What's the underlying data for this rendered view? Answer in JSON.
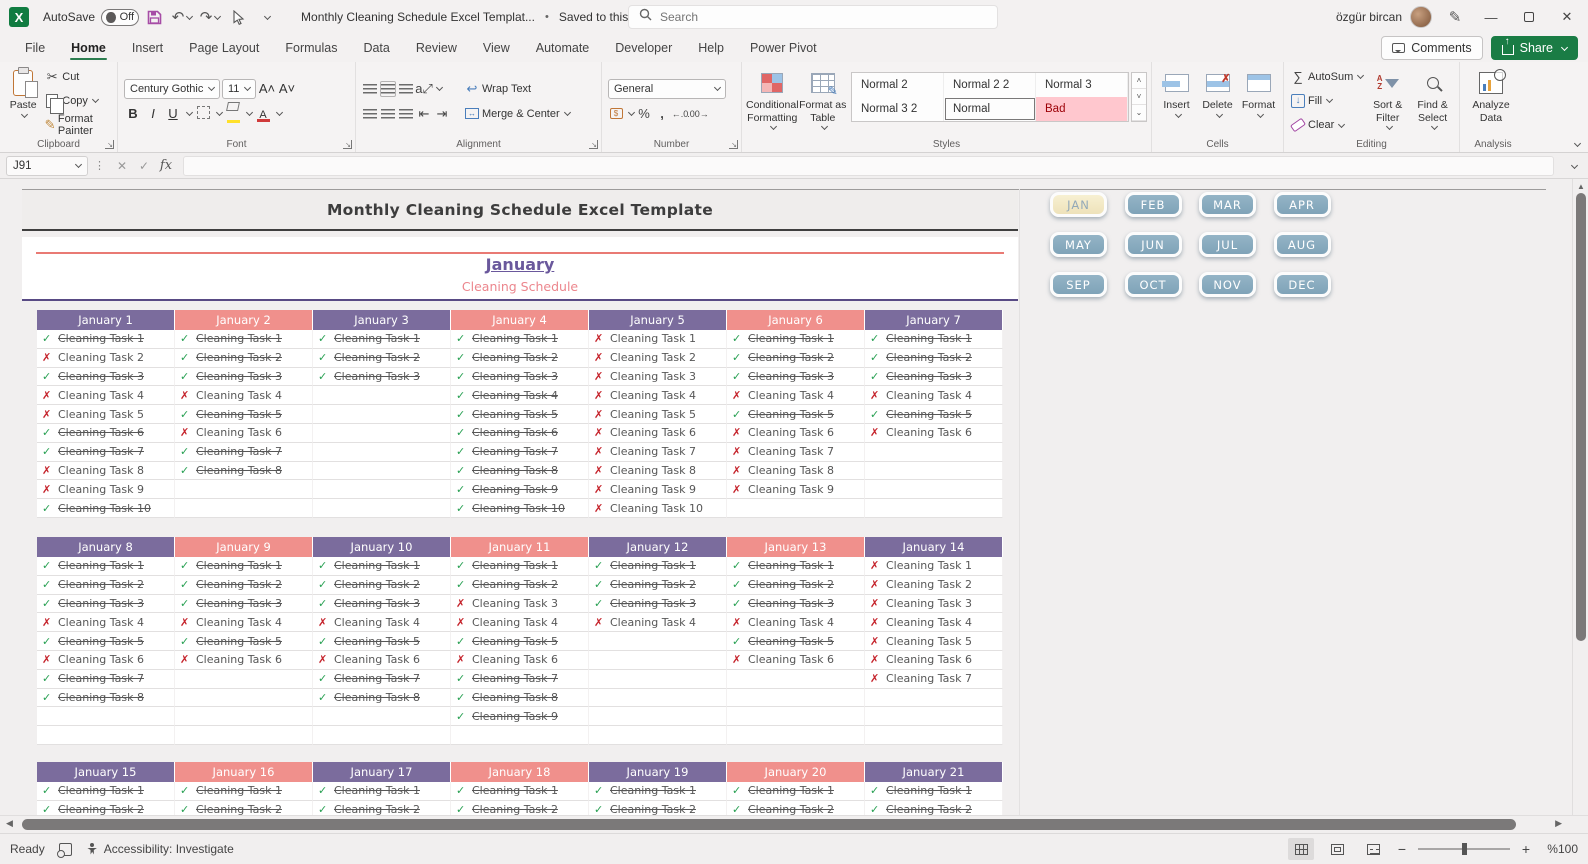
{
  "titlebar": {
    "app": "Excel",
    "autosave_label": "AutoSave",
    "autosave_state": "Off",
    "doc_title": "Monthly Cleaning Schedule Excel Templat...",
    "saved_status": "Saved to this PC",
    "search_placeholder": "Search",
    "user_name": "özgür bircan"
  },
  "ribbon_tabs": [
    {
      "label": "File",
      "active": false
    },
    {
      "label": "Home",
      "active": true
    },
    {
      "label": "Insert",
      "active": false
    },
    {
      "label": "Page Layout",
      "active": false
    },
    {
      "label": "Formulas",
      "active": false
    },
    {
      "label": "Data",
      "active": false
    },
    {
      "label": "Review",
      "active": false
    },
    {
      "label": "View",
      "active": false
    },
    {
      "label": "Automate",
      "active": false
    },
    {
      "label": "Developer",
      "active": false
    },
    {
      "label": "Help",
      "active": false
    },
    {
      "label": "Power Pivot",
      "active": false
    }
  ],
  "actions": {
    "comments": "Comments",
    "share": "Share"
  },
  "ribbon": {
    "clipboard": {
      "group": "Clipboard",
      "paste": "Paste",
      "cut": "Cut",
      "copy": "Copy",
      "format_painter": "Format Painter"
    },
    "font": {
      "group": "Font",
      "family": "Century Gothic",
      "size": "11"
    },
    "alignment": {
      "group": "Alignment",
      "wrap": "Wrap Text",
      "merge": "Merge & Center"
    },
    "number": {
      "group": "Number",
      "format": "General"
    },
    "styles": {
      "group": "Styles",
      "conditional": "Conditional\nFormatting",
      "format_table": "Format as\nTable",
      "gallery": [
        {
          "label": "Normal 2",
          "state": "normal"
        },
        {
          "label": "Normal 2 2",
          "state": "normal"
        },
        {
          "label": "Normal 3",
          "state": "normal"
        },
        {
          "label": "Normal 3 2",
          "state": "normal"
        },
        {
          "label": "Normal",
          "state": "selected"
        },
        {
          "label": "Bad",
          "state": "bad"
        }
      ]
    },
    "cells": {
      "group": "Cells",
      "insert": "Insert",
      "delete": "Delete",
      "format": "Format"
    },
    "editing": {
      "group": "Editing",
      "autosum": "AutoSum",
      "fill": "Fill",
      "clear": "Clear",
      "sort": "Sort &\nFilter",
      "find": "Find &\nSelect"
    },
    "analysis": {
      "group": "Analysis",
      "analyze": "Analyze\nData"
    }
  },
  "formula_bar": {
    "name_box": "J91"
  },
  "sheet": {
    "title": "Monthly Cleaning Schedule Excel Template",
    "month_title": "January",
    "subtitle": "Cleaning Schedule",
    "task_label_prefix": "Cleaning Task",
    "colors": {
      "header_purple": "#7b6c9d",
      "header_salmon": "#f0908c",
      "done_green": "#27a052",
      "missed_red": "#c5232b",
      "month_btn_blue": "#86a9bd",
      "month_btn_active": "#f3ecca"
    },
    "months": [
      {
        "label": "JAN",
        "active": true
      },
      {
        "label": "FEB",
        "active": false
      },
      {
        "label": "MAR",
        "active": false
      },
      {
        "label": "APR",
        "active": false
      },
      {
        "label": "MAY",
        "active": false
      },
      {
        "label": "JUN",
        "active": false
      },
      {
        "label": "JUL",
        "active": false
      },
      {
        "label": "AUG",
        "active": false
      },
      {
        "label": "SEP",
        "active": false
      },
      {
        "label": "OCT",
        "active": false
      },
      {
        "label": "NOV",
        "active": false
      },
      {
        "label": "DEC",
        "active": false
      }
    ],
    "weeks": [
      {
        "row_count": 10,
        "days": [
          {
            "label": "January 1",
            "accent": "purple",
            "tasks": [
              "d",
              "x",
              "d",
              "x",
              "x",
              "d",
              "d",
              "x",
              "x",
              "d"
            ]
          },
          {
            "label": "January 2",
            "accent": "salmon",
            "tasks": [
              "d",
              "d",
              "d",
              "x",
              "d",
              "x",
              "d",
              "d",
              "",
              ""
            ]
          },
          {
            "label": "January 3",
            "accent": "purple",
            "tasks": [
              "d",
              "d",
              "d",
              "",
              "",
              "",
              "",
              "",
              "",
              ""
            ]
          },
          {
            "label": "January 4",
            "accent": "salmon",
            "tasks": [
              "d",
              "d",
              "d",
              "d",
              "d",
              "d",
              "d",
              "d",
              "d",
              "d"
            ]
          },
          {
            "label": "January 5",
            "accent": "purple",
            "tasks": [
              "x",
              "x",
              "x",
              "x",
              "x",
              "x",
              "x",
              "x",
              "x",
              "x"
            ]
          },
          {
            "label": "January 6",
            "accent": "salmon",
            "tasks": [
              "d",
              "d",
              "d",
              "x",
              "d",
              "x",
              "x",
              "x",
              "x",
              ""
            ]
          },
          {
            "label": "January 7",
            "accent": "purple",
            "tasks": [
              "d",
              "d",
              "d",
              "x",
              "d",
              "x",
              "",
              "",
              "",
              ""
            ]
          }
        ]
      },
      {
        "row_count": 10,
        "days": [
          {
            "label": "January 8",
            "accent": "purple",
            "tasks": [
              "d",
              "d",
              "d",
              "x",
              "d",
              "x",
              "d",
              "d",
              "",
              ""
            ]
          },
          {
            "label": "January 9",
            "accent": "salmon",
            "tasks": [
              "d",
              "d",
              "d",
              "x",
              "d",
              "x",
              "",
              "",
              "",
              ""
            ]
          },
          {
            "label": "January 10",
            "accent": "purple",
            "tasks": [
              "d",
              "d",
              "d",
              "x",
              "d",
              "x",
              "d",
              "d",
              "",
              ""
            ]
          },
          {
            "label": "January 11",
            "accent": "salmon",
            "tasks": [
              "d",
              "d",
              "x",
              "x",
              "d",
              "x",
              "d",
              "d",
              "d",
              ""
            ]
          },
          {
            "label": "January 12",
            "accent": "purple",
            "tasks": [
              "d",
              "d",
              "d",
              "x",
              "",
              "",
              "",
              "",
              "",
              ""
            ]
          },
          {
            "label": "January 13",
            "accent": "salmon",
            "tasks": [
              "d",
              "d",
              "d",
              "x",
              "d",
              "x",
              "",
              "",
              "",
              ""
            ]
          },
          {
            "label": "January 14",
            "accent": "purple",
            "tasks": [
              "x",
              "x",
              "x",
              "x",
              "x",
              "x",
              "x",
              "",
              "",
              ""
            ]
          }
        ]
      },
      {
        "row_count": 2,
        "days": [
          {
            "label": "January 15",
            "accent": "purple",
            "tasks": [
              "d",
              "d"
            ]
          },
          {
            "label": "January 16",
            "accent": "salmon",
            "tasks": [
              "d",
              "d"
            ]
          },
          {
            "label": "January 17",
            "accent": "purple",
            "tasks": [
              "d",
              "d"
            ]
          },
          {
            "label": "January 18",
            "accent": "salmon",
            "tasks": [
              "d",
              "d"
            ]
          },
          {
            "label": "January 19",
            "accent": "purple",
            "tasks": [
              "d",
              "d"
            ]
          },
          {
            "label": "January 20",
            "accent": "salmon",
            "tasks": [
              "d",
              "d"
            ]
          },
          {
            "label": "January 21",
            "accent": "purple",
            "tasks": [
              "d",
              "d"
            ]
          }
        ]
      }
    ]
  },
  "statusbar": {
    "ready": "Ready",
    "accessibility": "Accessibility: Investigate",
    "zoom": "%100"
  }
}
